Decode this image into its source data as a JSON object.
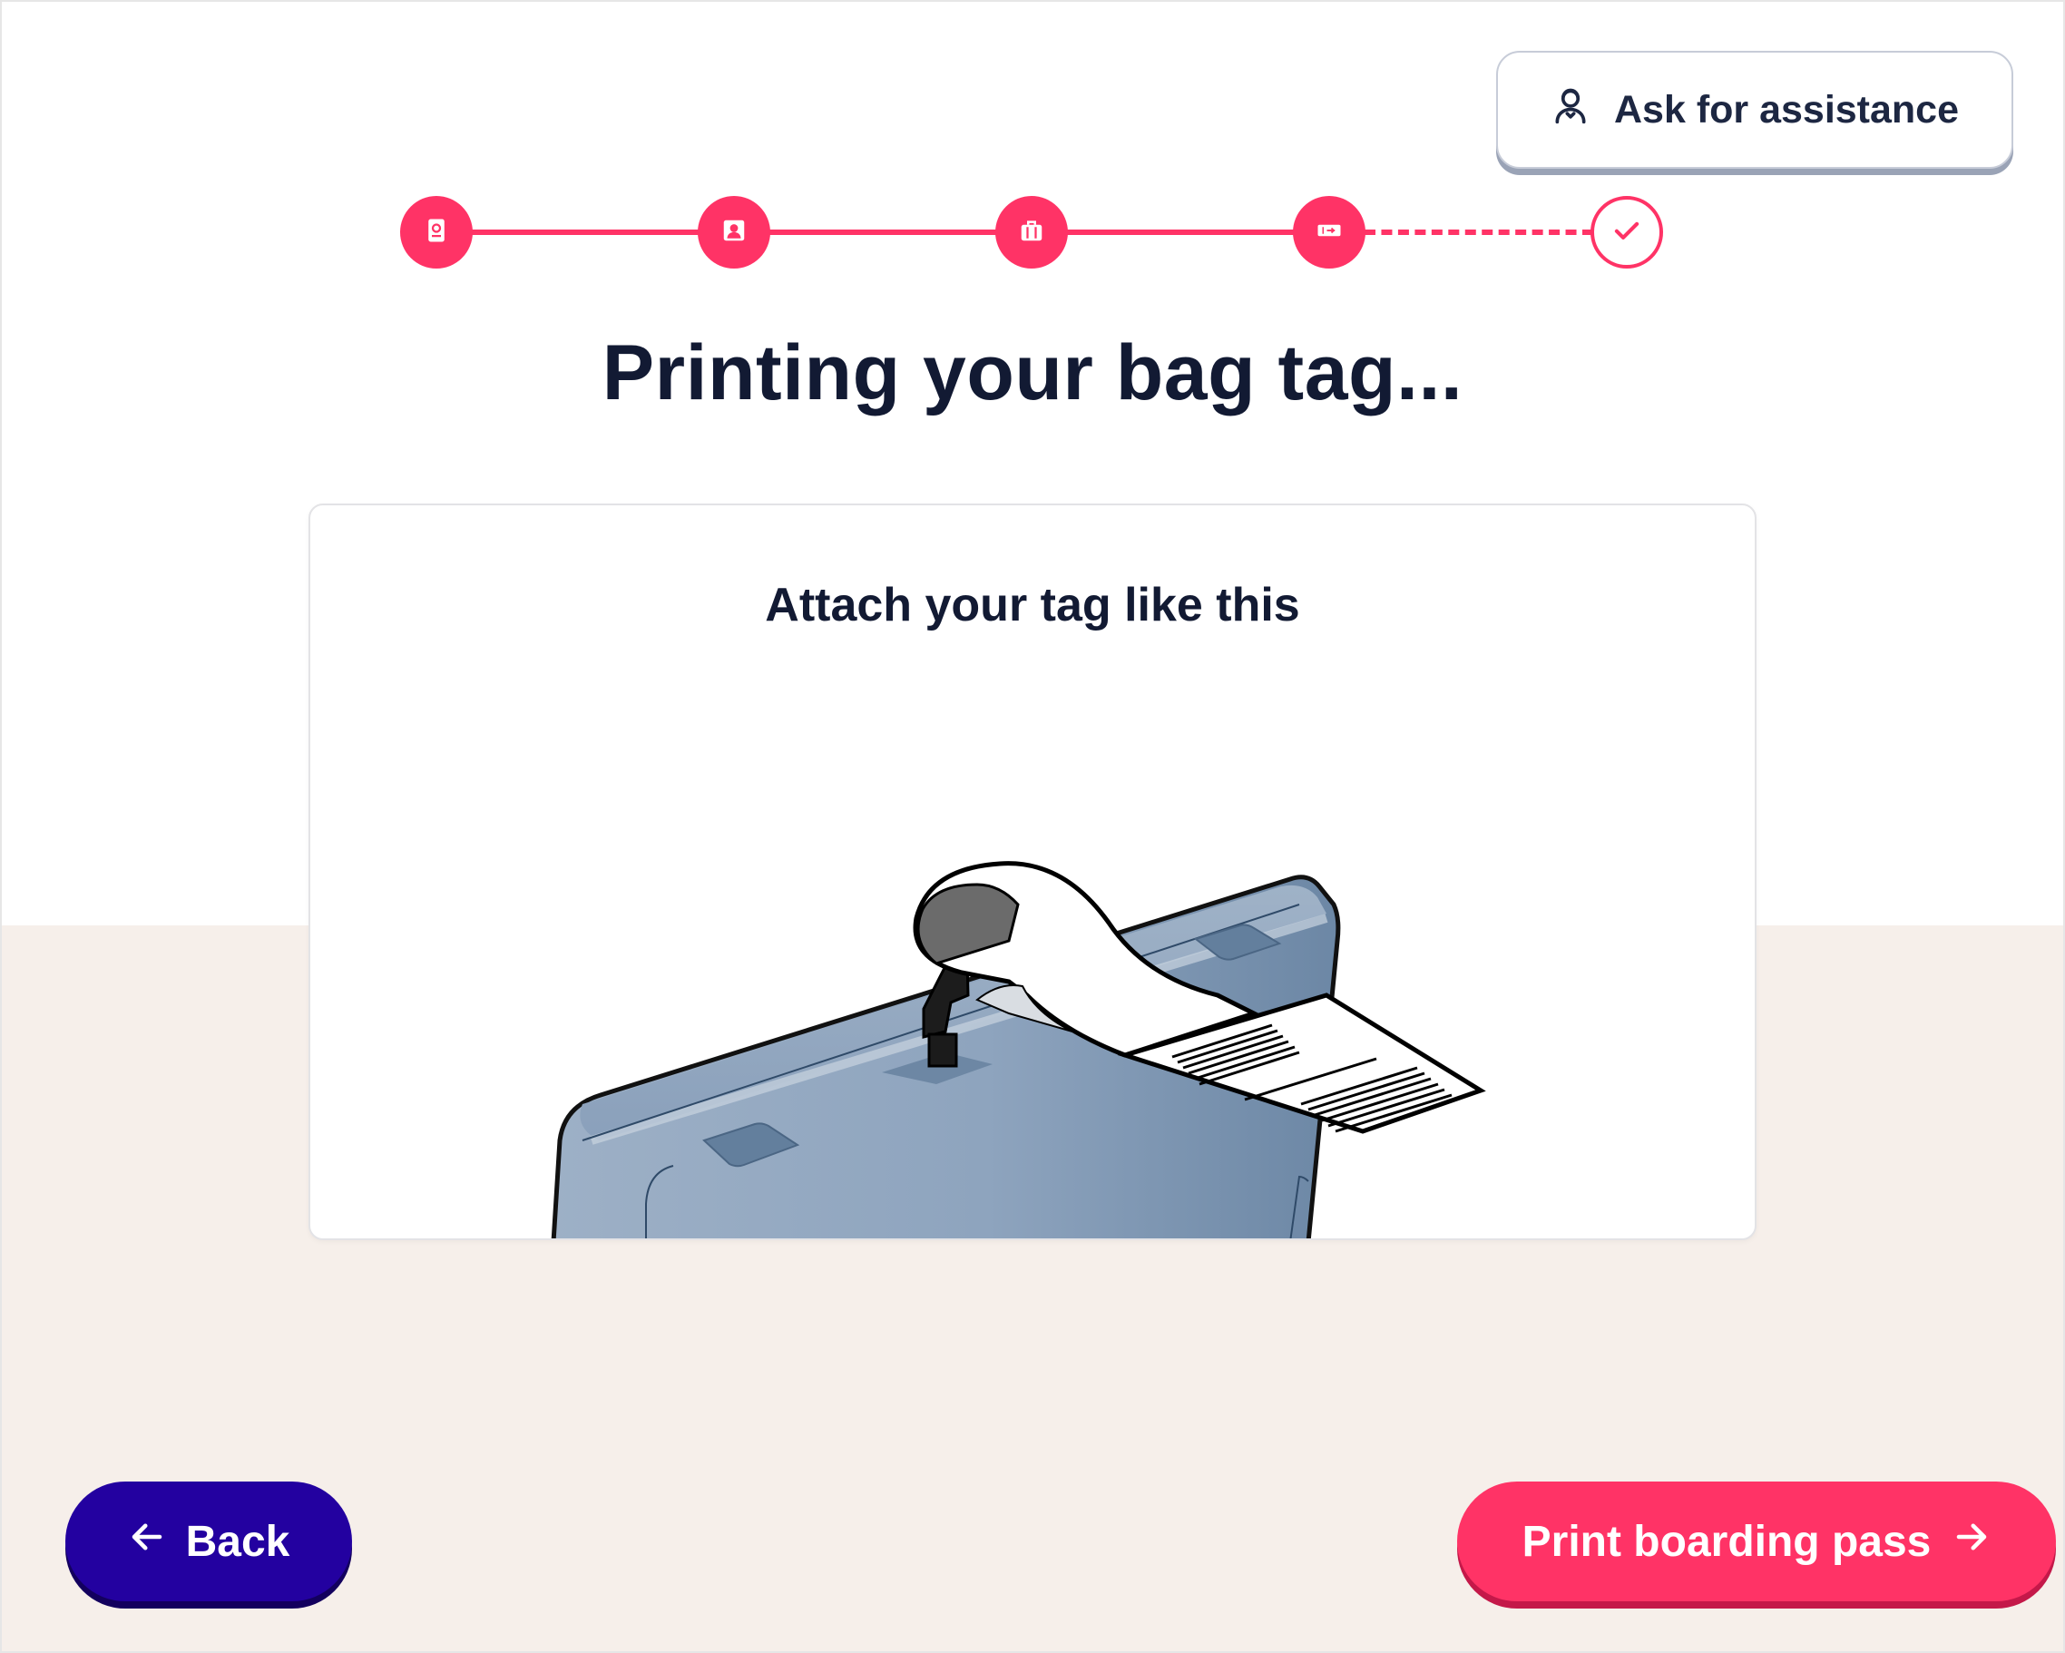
{
  "header": {
    "assist_label": "Ask for assistance",
    "assist_icon": "agent-icon"
  },
  "progress": {
    "steps": [
      {
        "icon": "passport-icon",
        "state": "complete"
      },
      {
        "icon": "passenger-icon",
        "state": "complete"
      },
      {
        "icon": "baggage-icon",
        "state": "complete"
      },
      {
        "icon": "boarding-pass-icon",
        "state": "current"
      },
      {
        "icon": "check-icon",
        "state": "upcoming"
      }
    ]
  },
  "main": {
    "title": "Printing your bag tag...",
    "card_title": "Attach your tag like this",
    "illustration": "suitcase-with-bag-tag-illustration"
  },
  "footer": {
    "back_label": "Back",
    "back_icon": "arrow-left-icon",
    "next_label": "Print boarding pass",
    "next_icon": "arrow-right-icon"
  },
  "colors": {
    "accent": "#ff3366",
    "primary_dark": "#2301a0",
    "text": "#121a33",
    "bottom_band": "#f6efea",
    "suitcase": "#8da4bf"
  }
}
